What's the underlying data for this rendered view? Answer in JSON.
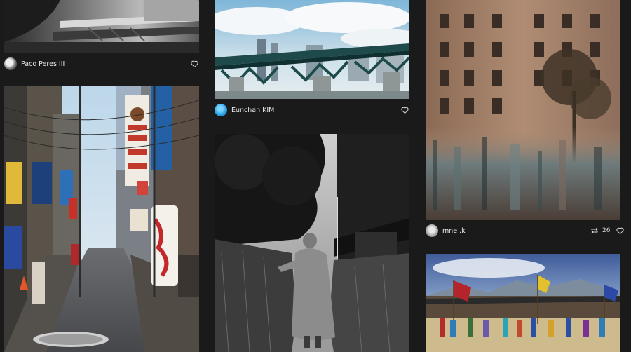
{
  "cards": [
    {
      "author": "Paco Peres III"
    },
    {
      "author": "Eunchan KIM"
    },
    {
      "author": "mne .k",
      "repost_count": "26"
    },
    {
      "author": ""
    },
    {
      "author": ""
    },
    {
      "author": ""
    }
  ],
  "colors": {
    "background": "#1a1a1a",
    "text": "#e6e6e6",
    "avatar_blue": "#2aa6e8"
  },
  "icons": [
    "heart-icon",
    "repost-icon"
  ]
}
